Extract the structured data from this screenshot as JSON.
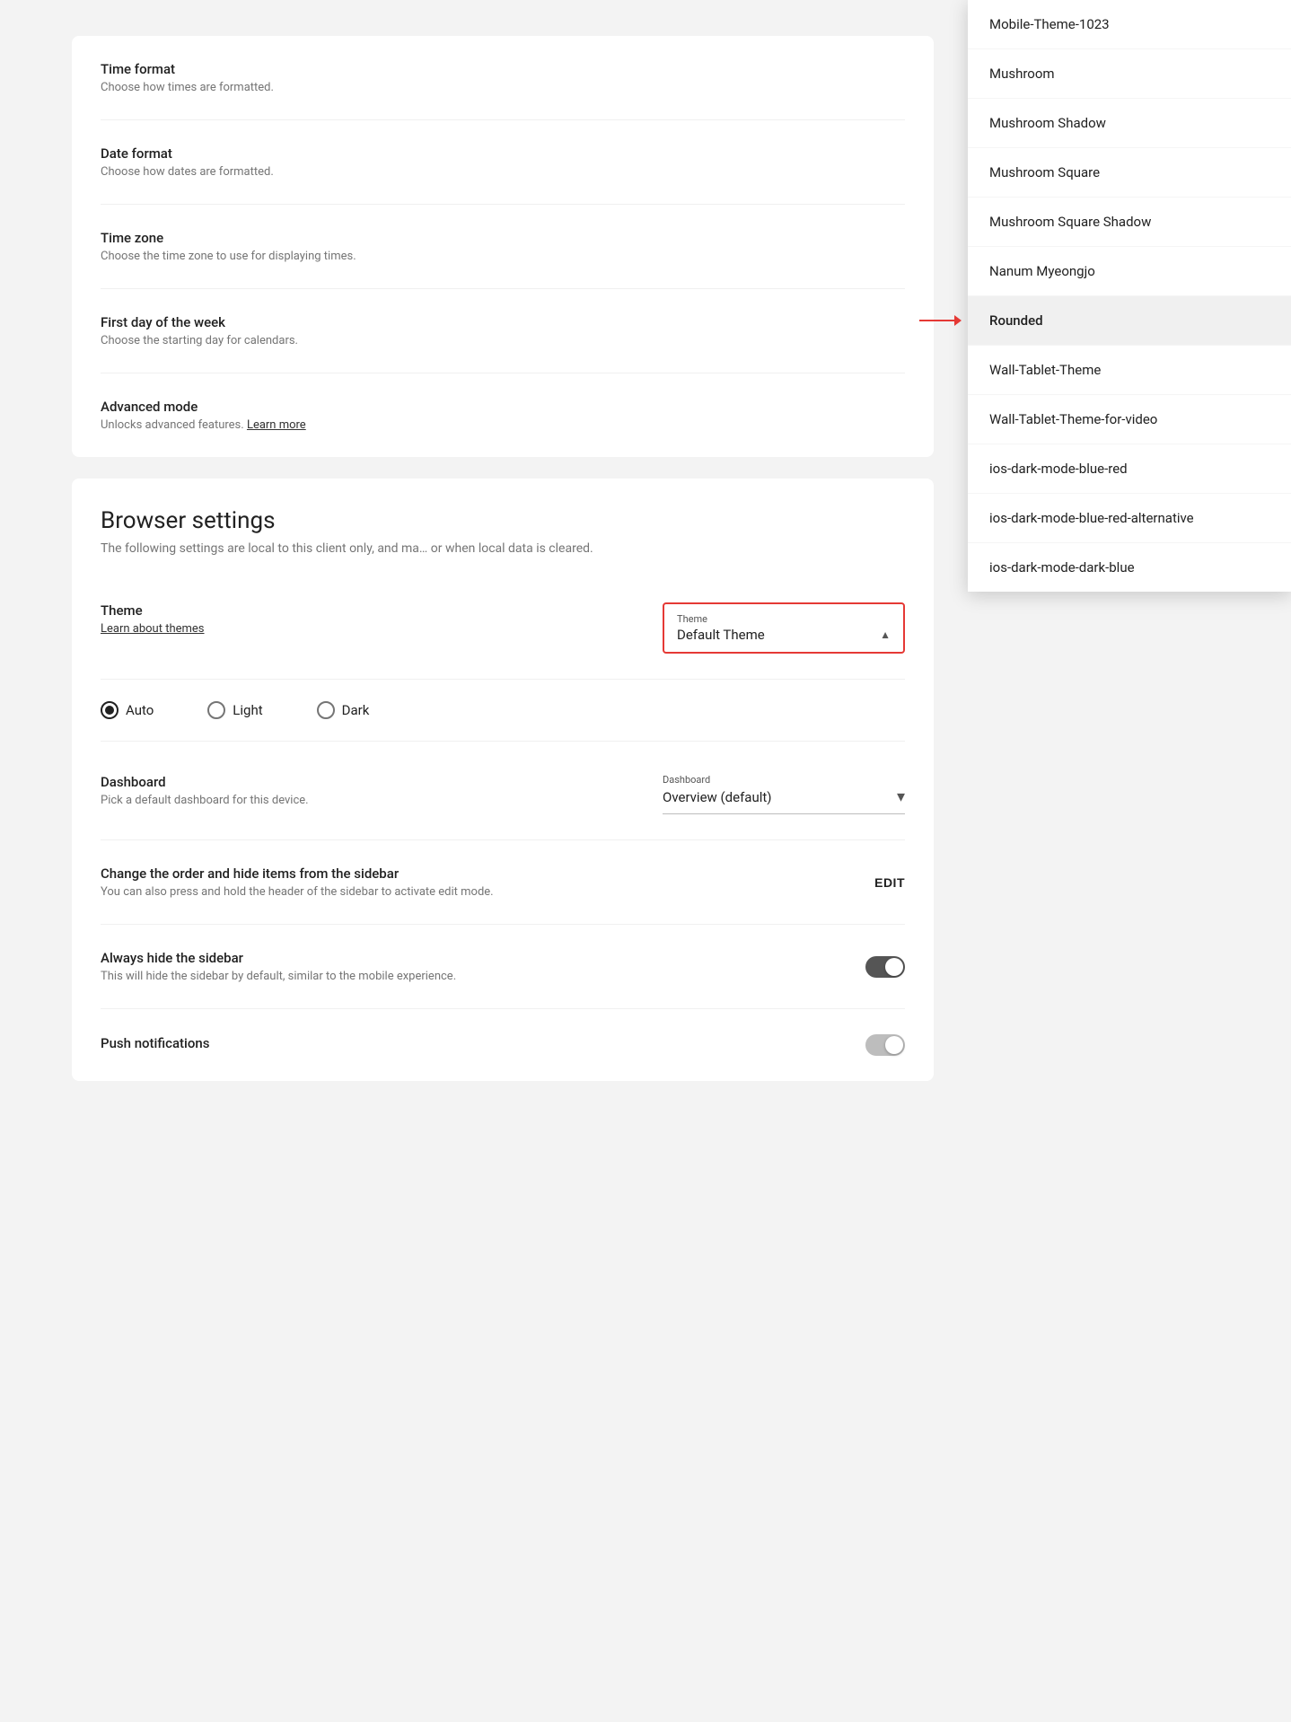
{
  "settings": {
    "timeFormat": {
      "title": "Time format",
      "desc": "Choose how times are formatted."
    },
    "dateFormat": {
      "title": "Date format",
      "desc": "Choose how dates are formatted."
    },
    "timeZone": {
      "title": "Time zone",
      "desc": "Choose the time zone to use for displaying times."
    },
    "firstDay": {
      "title": "First day of the week",
      "desc": "Choose the starting day for calendars."
    },
    "advancedMode": {
      "title": "Advanced mode",
      "desc": "Unlocks advanced features.",
      "link": "Learn more"
    }
  },
  "browserSettings": {
    "sectionTitle": "Browser settings",
    "sectionDesc": "The following settings are local to this client only, and ma… or when local data is cleared.",
    "theme": {
      "title": "Theme",
      "link": "Learn about themes",
      "selectLabel": "Theme",
      "selectValue": "Default Theme"
    },
    "radioOptions": [
      {
        "label": "Auto",
        "selected": true
      },
      {
        "label": "Light",
        "selected": false
      },
      {
        "label": "Dark",
        "selected": false
      }
    ],
    "dashboard": {
      "title": "Dashboard",
      "desc": "Pick a default dashboard for this device.",
      "selectLabel": "Dashboard",
      "selectValue": "Overview (default)"
    },
    "sidebarOrder": {
      "title": "Change the order and hide items from the sidebar",
      "desc": "You can also press and hold the header of the sidebar to activate edit mode.",
      "editLabel": "EDIT"
    },
    "alwaysHideSidebar": {
      "title": "Always hide the sidebar",
      "desc": "This will hide the sidebar by default, similar to the mobile experience.",
      "toggleOn": true
    },
    "pushNotifications": {
      "title": "Push notifications",
      "toggleOn": false
    }
  },
  "dropdown": {
    "items": [
      {
        "label": "Mobile-Theme-1023",
        "highlighted": false
      },
      {
        "label": "Mushroom",
        "highlighted": false
      },
      {
        "label": "Mushroom Shadow",
        "highlighted": false
      },
      {
        "label": "Mushroom Square",
        "highlighted": false
      },
      {
        "label": "Mushroom Square Shadow",
        "highlighted": false
      },
      {
        "label": "Nanum Myeongjo",
        "highlighted": false
      },
      {
        "label": "Rounded",
        "highlighted": true
      },
      {
        "label": "Wall-Tablet-Theme",
        "highlighted": false
      },
      {
        "label": "Wall-Tablet-Theme-for-video",
        "highlighted": false
      },
      {
        "label": "ios-dark-mode-blue-red",
        "highlighted": false
      },
      {
        "label": "ios-dark-mode-blue-red-alternative",
        "highlighted": false
      },
      {
        "label": "ios-dark-mode-dark-blue",
        "highlighted": false
      }
    ]
  }
}
